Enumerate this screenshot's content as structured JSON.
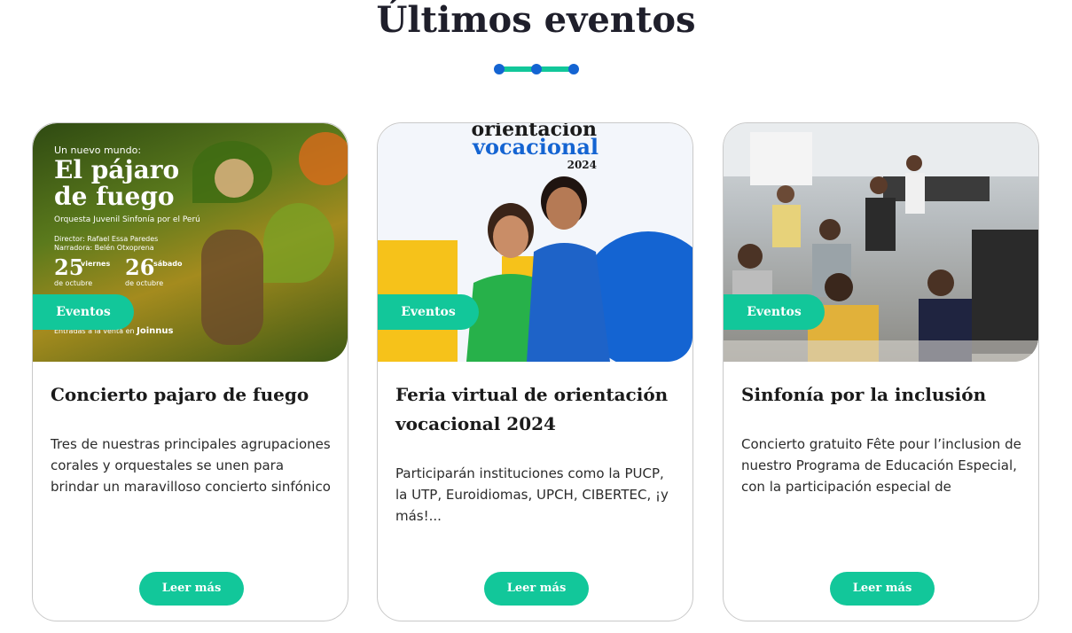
{
  "section": {
    "title": "Últimos eventos"
  },
  "colors": {
    "accent": "#12c79a",
    "dot": "#1464d2",
    "title": "#1f1f2b"
  },
  "cards": [
    {
      "badge": "Eventos",
      "title": "Concierto pajaro de fuego",
      "text": "Tres de nuestras principales agrupaciones corales y orquestales se unen para brindar un maravilloso concierto sinfónico",
      "button": "Leer más",
      "poster": {
        "kicker": "Un nuevo mundo:",
        "headline_1": "El pájaro",
        "headline_2": "de fuego",
        "orchestra": "Orquesta Juvenil Sinfonía por el Perú",
        "director": "Director: Rafael Essa Paredes",
        "narrator": "Narradora: Belén Otxoprena",
        "date_1_day": "25",
        "date_1_weekday": "viernes",
        "date_1_month": "de octubre",
        "date_2_day": "26",
        "date_2_weekday": "sábado",
        "date_2_month": "de octubre",
        "ticket": "Entradas a la venta en",
        "ticket_brand": "Joinnus"
      }
    },
    {
      "badge": "Eventos",
      "title": "Feria virtual de orientación vocacional 2024",
      "text": "Participarán instituciones como la PUCP, la UTP, Euroidiomas, UPCH, CIBERTEC, ¡y más!...",
      "button": "Leer más",
      "poster": {
        "line_1": "orientación",
        "line_2": "vocacional",
        "line_3": "2024"
      }
    },
    {
      "badge": "Eventos",
      "title": "Sinfonía por la inclusión",
      "text": "Concierto gratuito Fête pour l’inclusion de nuestro Programa de Educación Especial, con la participación especial de",
      "button": "Leer más"
    }
  ]
}
